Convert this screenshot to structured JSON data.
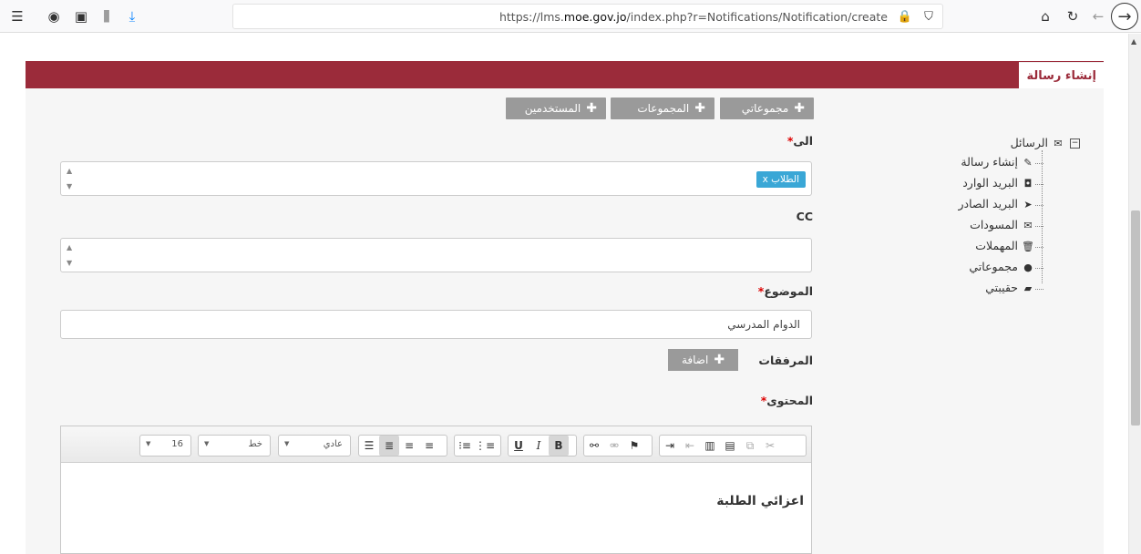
{
  "browser": {
    "url_prefix": "https://lms.",
    "url_domain": "moe.gov.jo",
    "url_suffix": "/index.php?r=Notifications/Notification/create"
  },
  "header": {
    "title": "إنشاء رسالة"
  },
  "recipient_buttons": [
    {
      "label": "مجموعاتي"
    },
    {
      "label": "المجموعات"
    },
    {
      "label": "المستخدمين"
    }
  ],
  "form": {
    "to_label": "الى",
    "to_tag": "الطلاب x",
    "cc_label": "CC",
    "subject_label": "الموضوع",
    "subject_value": "الدوام المدرسي",
    "attachments_label": "المرفقات",
    "add_label": "اضافة",
    "content_label": "المحتوى",
    "required_mark": "*"
  },
  "editor": {
    "font_size": "16",
    "font_name": "خط",
    "format": "عادي",
    "body_text": "اعزائي الطلبة"
  },
  "tree": {
    "root": "الرسائل",
    "items": [
      {
        "label": "إنشاء رسالة"
      },
      {
        "label": "البريد الوارد"
      },
      {
        "label": "البريد الصادر"
      },
      {
        "label": "المسودات"
      },
      {
        "label": "المهملات"
      },
      {
        "label": "مجموعاتي"
      },
      {
        "label": "حقيبتي"
      }
    ]
  }
}
